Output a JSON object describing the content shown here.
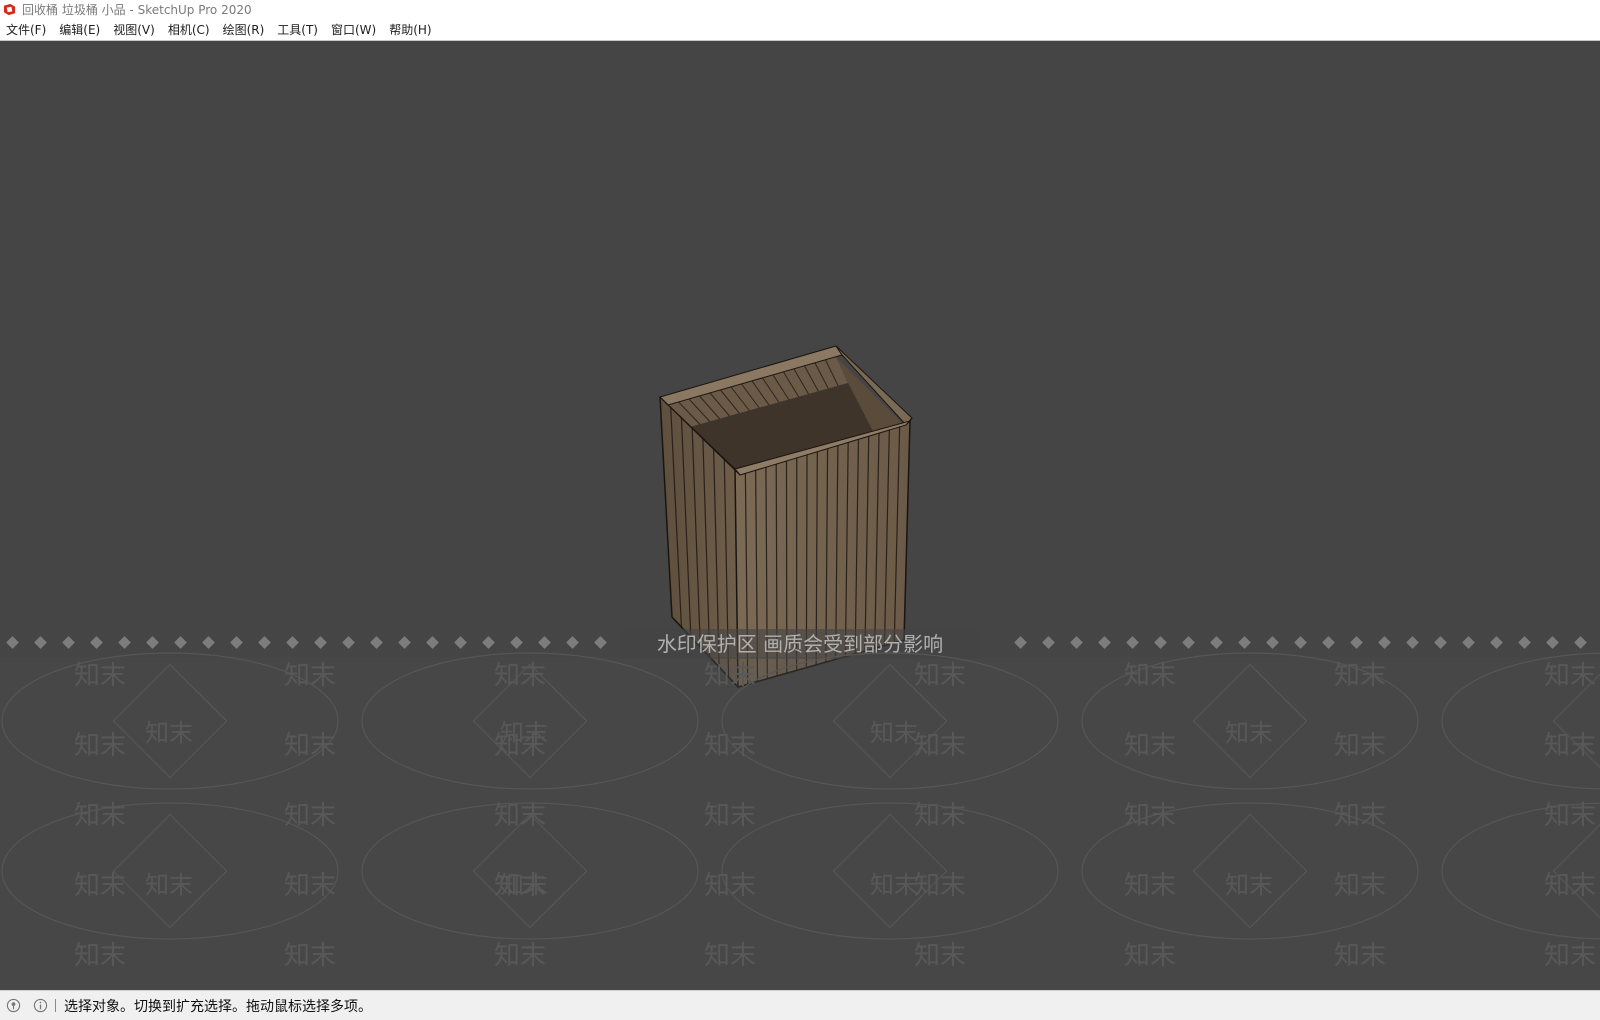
{
  "window": {
    "title": "回收桶 垃圾桶 小品 - SketchUp Pro 2020"
  },
  "menubar": {
    "items": [
      {
        "label": "文件(F)"
      },
      {
        "label": "编辑(E)"
      },
      {
        "label": "视图(V)"
      },
      {
        "label": "相机(C)"
      },
      {
        "label": "绘图(R)"
      },
      {
        "label": "工具(T)"
      },
      {
        "label": "窗口(W)"
      },
      {
        "label": "帮助(H)"
      }
    ]
  },
  "watermark": {
    "notice": "水印保护区  画质会受到部分影响",
    "brand": "知末"
  },
  "statusbar": {
    "icons": [
      "geo-location-icon",
      "info-icon"
    ],
    "message": "选择对象。切换到扩充选择。拖动鼠标选择多项。"
  },
  "colors": {
    "viewport_bg": "#454545",
    "wood_light": "#8a7862",
    "wood_dark": "#4a3d30",
    "edge": "#1a1510"
  }
}
